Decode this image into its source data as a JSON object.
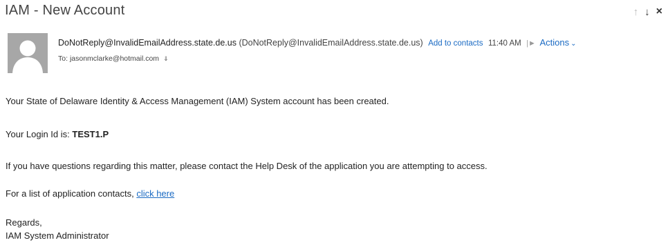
{
  "header": {
    "subject": "IAM - New Account",
    "nav_up": "↑",
    "nav_down": "↓",
    "close": "×"
  },
  "message": {
    "sender_email": "DoNotReply@InvalidEmailAddress.state.de.us",
    "sender_full": "(DoNotReply@InvalidEmailAddress.state.de.us)",
    "add_to_contacts": "Add to contacts",
    "time": "11:40 AM",
    "actions_label": "Actions",
    "to_label": "To:",
    "to_address": "jasonmclarke@hotmail.com"
  },
  "body": {
    "line1": "Your State of Delaware Identity & Access Management (IAM) System account has been created.",
    "login_prefix": "Your Login Id is: ",
    "login_id": "TEST1.P",
    "line3": "If you have questions regarding this matter, please contact the Help Desk of the application you are attempting to access.",
    "contacts_prefix": "For a list of application contacts, ",
    "contacts_link": "click here",
    "regards": "Regards,",
    "signature": "IAM System Administrator"
  },
  "colors": {
    "link": "#1a6ac3",
    "avatar_bg": "#a7a7a7"
  }
}
